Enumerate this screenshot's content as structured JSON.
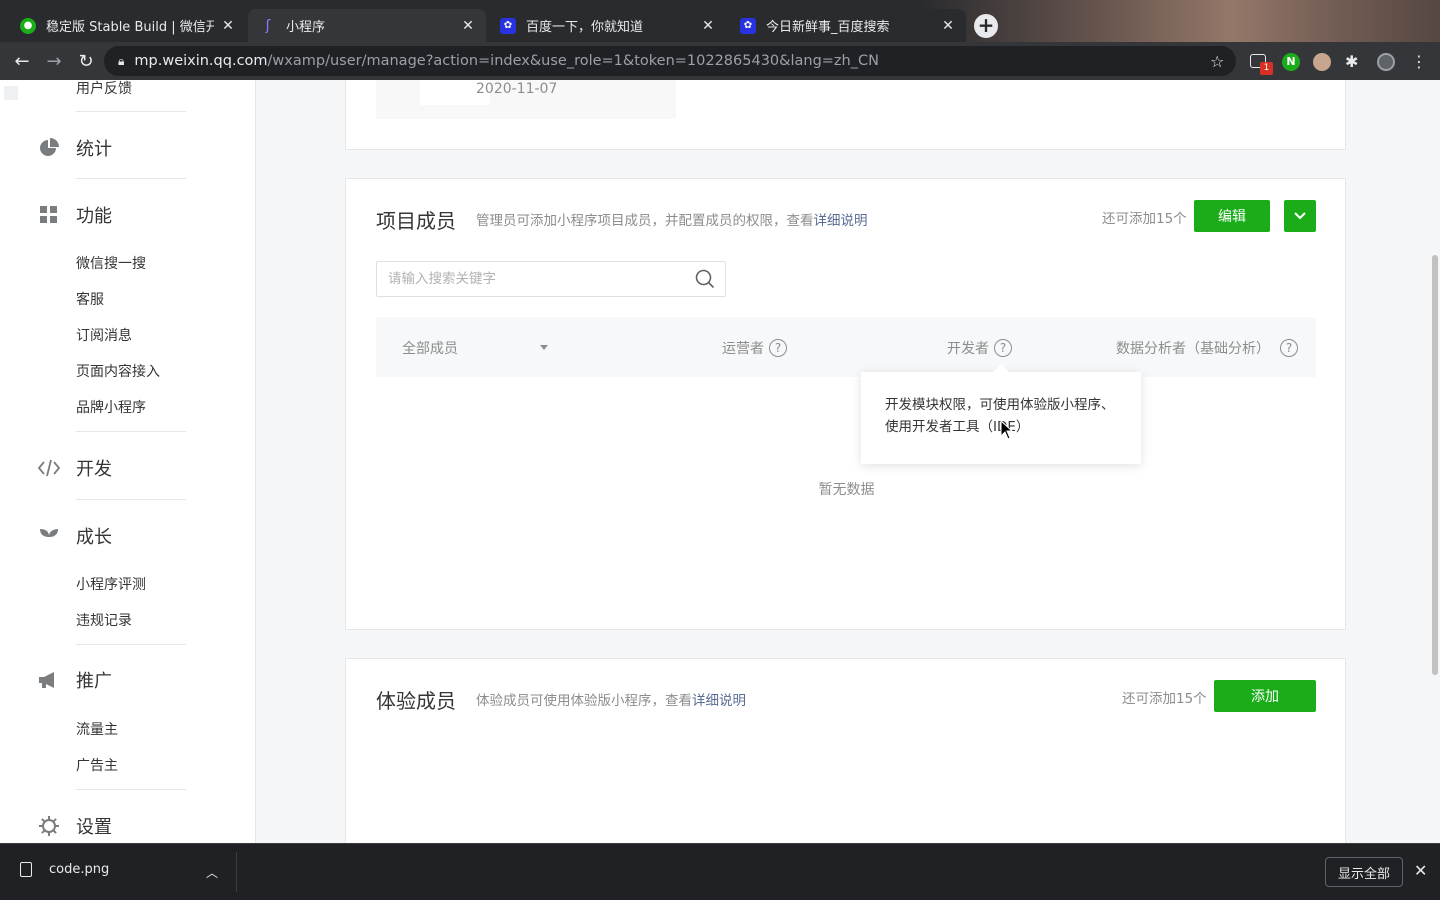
{
  "browser": {
    "tabs": [
      {
        "title": "稳定版 Stable Build | 微信开放文",
        "favicon": "wechat-icon",
        "state": "inactive"
      },
      {
        "title": "小程序",
        "favicon": "miniprogram-icon",
        "state": "active"
      },
      {
        "title": "百度一下，你就知道",
        "favicon": "baidu-icon",
        "state": "inactive"
      },
      {
        "title": "今日新鲜事_百度搜索",
        "favicon": "baidu-icon",
        "state": "inactive"
      }
    ],
    "new_tab": "+",
    "url_host": "mp.weixin.qq.com",
    "url_path": "/wxamp/user/manage?action=index&use_role=1&token=1022865430&lang=zh_CN",
    "ext_badge": "1"
  },
  "sidebar": {
    "top_item": "用户反馈",
    "groups": [
      {
        "label": "统计",
        "icon": "pie-chart-icon"
      },
      {
        "label": "功能",
        "icon": "grid-icon",
        "items": [
          "微信搜一搜",
          "客服",
          "订阅消息",
          "页面内容接入",
          "品牌小程序"
        ]
      },
      {
        "label": "开发",
        "icon": "code-icon"
      },
      {
        "label": "成长",
        "icon": "sprout-icon",
        "items": [
          "小程序评测",
          "违规记录"
        ]
      },
      {
        "label": "推广",
        "icon": "megaphone-icon",
        "items": [
          "流量主",
          "广告主"
        ]
      },
      {
        "label": "设置",
        "icon": "gear-icon"
      }
    ]
  },
  "top_card": {
    "date": "2020-11-07"
  },
  "members": {
    "title": "项目成员",
    "desc": "管理员可添加小程序项目成员，并配置成员的权限，查看",
    "desc_link": "详细说明",
    "quota": "还可添加15个",
    "edit_label": "编辑",
    "search_placeholder": "请输入搜索关键字",
    "columns": {
      "filter": "全部成员",
      "operator": "运营者",
      "developer": "开发者",
      "analyst": "数据分析者（基础分析）"
    },
    "qmark": "?",
    "empty": "暂无数据",
    "tooltip": "开发模块权限，可使用体验版小程序、使用开发者工具（IDE）"
  },
  "trial": {
    "title": "体验成员",
    "desc": "体验成员可使用体验版小程序，查看",
    "desc_link": "详细说明",
    "quota": "还可添加15个",
    "add_label": "添加"
  },
  "download_bar": {
    "file": "code.png",
    "show_all": "显示全部"
  },
  "colors": {
    "accent": "#1aad19",
    "link": "#576b95"
  }
}
